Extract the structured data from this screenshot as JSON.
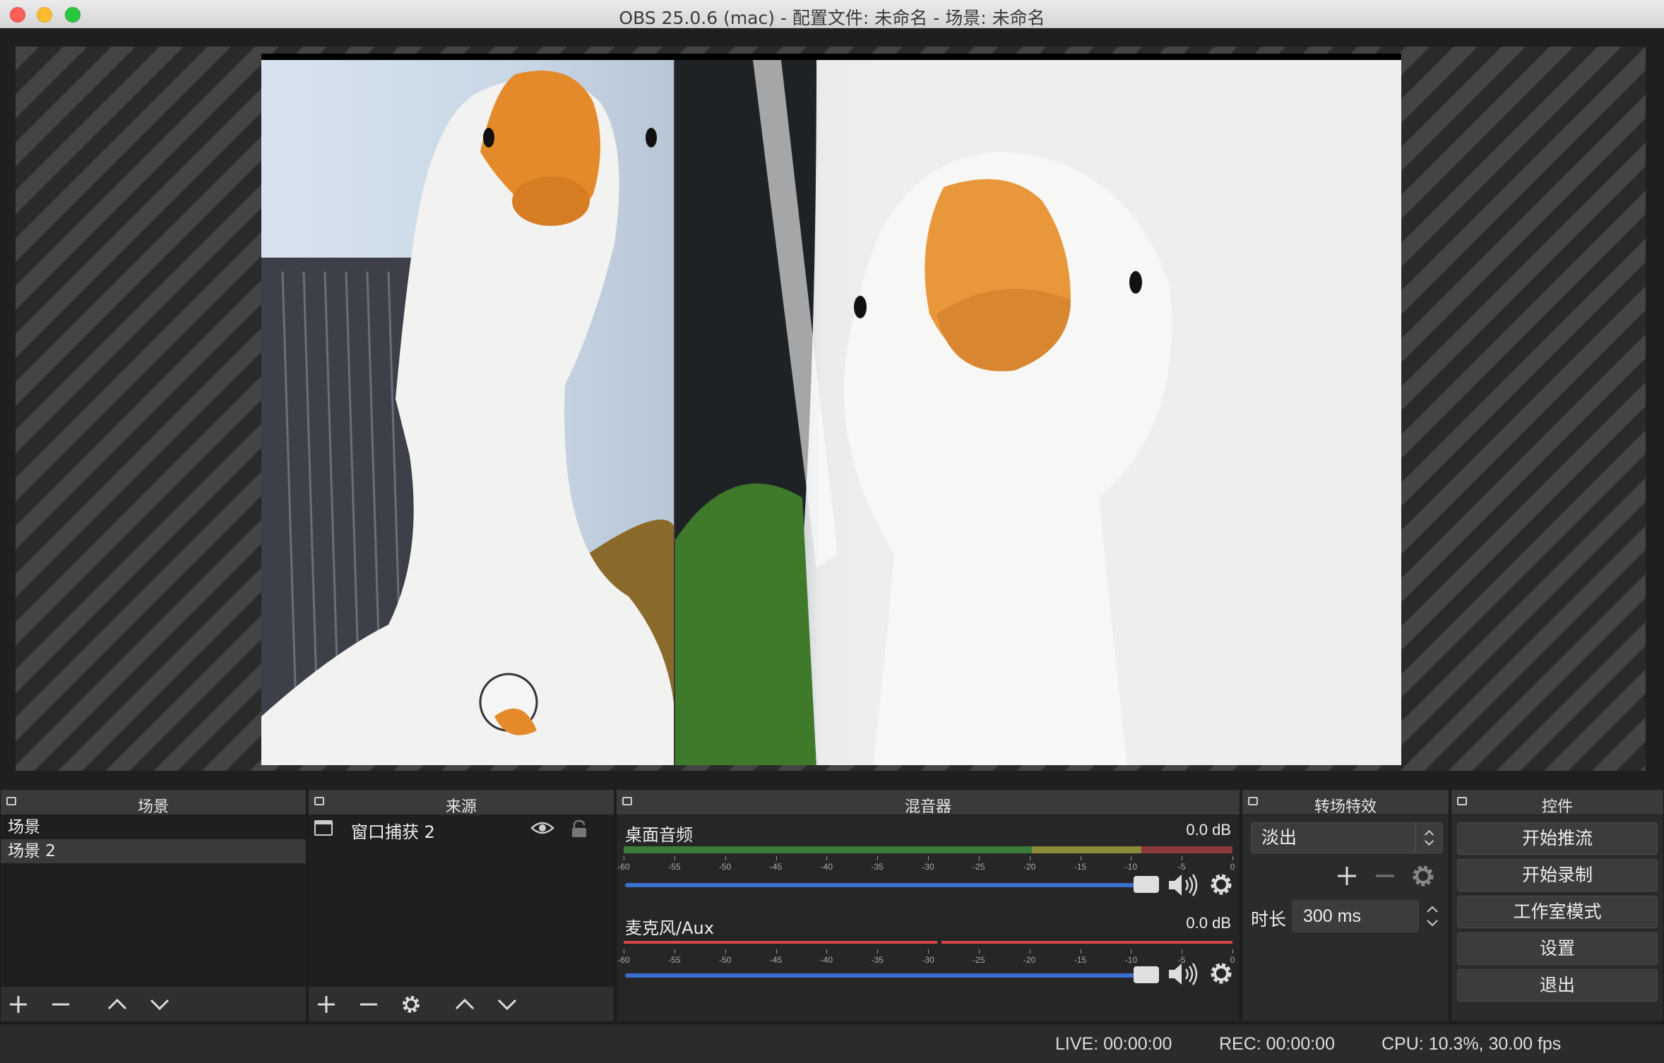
{
  "window": {
    "title": "OBS 25.0.6 (mac) - 配置文件: 未命名 - 场景: 未命名"
  },
  "scenes": {
    "title": "场景",
    "items": [
      "场景",
      "场景 2"
    ],
    "selected_index": 1
  },
  "sources": {
    "title": "来源",
    "items": [
      {
        "label": "窗口捕获 2",
        "icon": "window-icon",
        "visible": true,
        "locked": false
      }
    ]
  },
  "mixer": {
    "title": "混音器",
    "tick_labels": [
      "-60",
      "-55",
      "-50",
      "-45",
      "-40",
      "-35",
      "-30",
      "-25",
      "-20",
      "-15",
      "-10",
      "-5",
      "0"
    ],
    "tracks": [
      {
        "name": "桌面音频",
        "db": "0.0 dB",
        "volume": 1.0
      },
      {
        "name": "麦克风/Aux",
        "db": "0.0 dB",
        "volume": 1.0
      }
    ]
  },
  "transitions": {
    "title": "转场特效",
    "selected": "淡出",
    "duration_label": "时长",
    "duration_value": "300 ms"
  },
  "controls": {
    "title": "控件",
    "buttons": [
      "开始推流",
      "开始录制",
      "工作室模式",
      "设置",
      "退出"
    ]
  },
  "status": {
    "live": "LIVE: 00:00:00",
    "rec": "REC: 00:00:00",
    "cpu": "CPU: 10.3%, 30.00 fps"
  },
  "colors": {
    "accent_slider": "#3b6fd0",
    "meter_green": "#3c7a3c",
    "meter_yellow": "#8a8a3a",
    "meter_red": "#8a3a3a"
  }
}
